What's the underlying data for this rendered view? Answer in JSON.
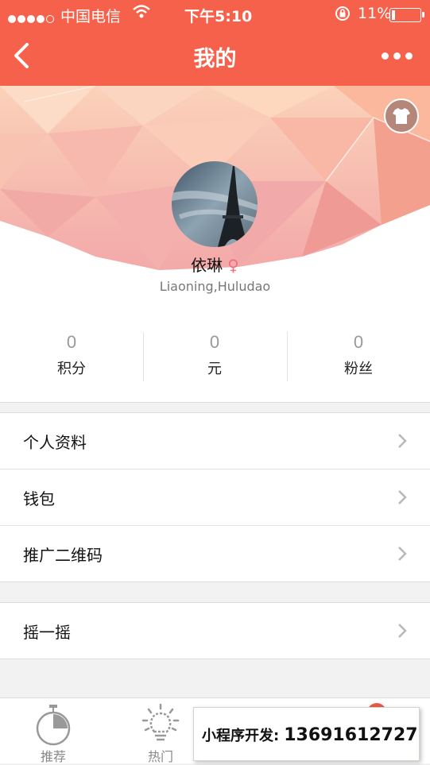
{
  "status_bar": {
    "carrier": "中国电信",
    "time": "下午5:10",
    "battery": "11%"
  },
  "navbar": {
    "title": "我的"
  },
  "profile": {
    "name": "依琳",
    "gender_symbol": "♀",
    "location": "Liaoning,Huludao"
  },
  "stats": [
    {
      "value": "0",
      "label": "积分"
    },
    {
      "value": "0",
      "label": "元"
    },
    {
      "value": "0",
      "label": "粉丝"
    }
  ],
  "menu_group_1": [
    {
      "label": "个人资料"
    },
    {
      "label": "钱包"
    },
    {
      "label": "推广二维码"
    }
  ],
  "menu_group_2": [
    {
      "label": "摇一摇"
    }
  ],
  "tabbar": {
    "tabs": [
      {
        "label": "推荐",
        "icon": "stopwatch-icon"
      },
      {
        "label": "热门",
        "icon": "lightbulb-icon"
      }
    ]
  },
  "promo": {
    "label": "小程序开发:",
    "phone": "13691612727"
  },
  "colors": {
    "accent": "#f5614a",
    "gender": "#f07080"
  }
}
